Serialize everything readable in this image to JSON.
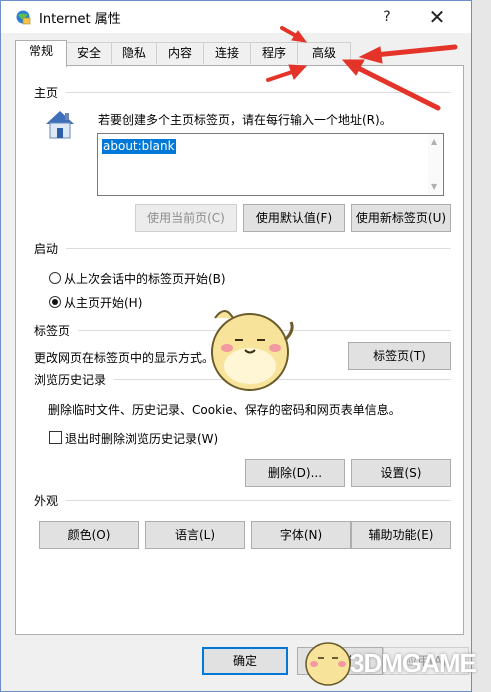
{
  "window": {
    "title": "Internet 属性",
    "help_label": "?",
    "close_label": "✕"
  },
  "tabs": [
    {
      "label": "常规",
      "selected": true
    },
    {
      "label": "安全",
      "selected": false
    },
    {
      "label": "隐私",
      "selected": false
    },
    {
      "label": "内容",
      "selected": false
    },
    {
      "label": "连接",
      "selected": false
    },
    {
      "label": "程序",
      "selected": false
    },
    {
      "label": "高级",
      "selected": false
    }
  ],
  "home": {
    "heading": "主页",
    "instruction": "若要创建多个主页标签页，请在每行输入一个地址(R)。",
    "address_value": "about:blank",
    "icon": "house-icon",
    "buttons": {
      "use_current": "使用当前页(C)",
      "use_default": "使用默认值(F)",
      "use_new_tab": "使用新标签页(U)"
    }
  },
  "startup": {
    "heading": "启动",
    "options": [
      {
        "label": "从上次会话中的标签页开始(B)",
        "selected": false
      },
      {
        "label": "从主页开始(H)",
        "selected": true
      }
    ]
  },
  "tabs_section": {
    "heading": "标签页",
    "description": "更改网页在标签页中的显示方式。",
    "button": "标签页(T)"
  },
  "history": {
    "heading": "浏览历史记录",
    "description": "删除临时文件、历史记录、Cookie、保存的密码和网页表单信息。",
    "checkbox_label": "退出时删除浏览历史记录(W)",
    "checkbox_checked": false,
    "delete_button": "删除(D)...",
    "settings_button": "设置(S)"
  },
  "appearance": {
    "heading": "外观",
    "buttons": [
      "颜色(O)",
      "语言(L)",
      "字体(N)",
      "辅助功能(E)"
    ]
  },
  "footer": {
    "ok": "确定",
    "cancel": "取消",
    "apply": "应用(A)"
  },
  "watermark": "3DMGAME",
  "colors": {
    "accent": "#0078d7",
    "annotation_arrow": "#e4342a"
  }
}
